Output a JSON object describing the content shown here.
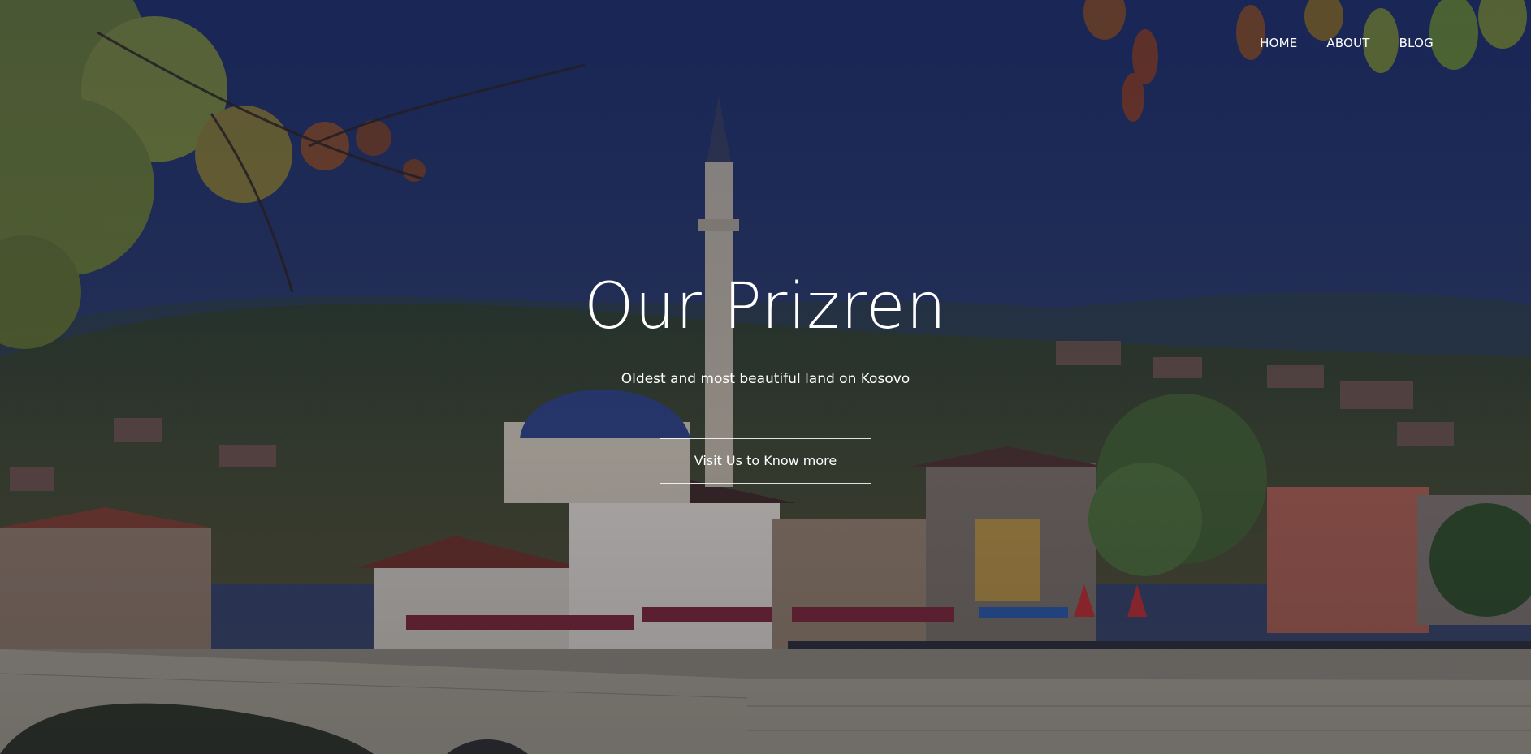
{
  "nav": {
    "home_label": "HOME",
    "about_label": "ABOUT",
    "blog_label": "BLOG"
  },
  "hero": {
    "title": "Our Prizren",
    "subtitle": "Oldest and most beautiful land on Kosovo",
    "cta_label": "Visit Us to Know more"
  },
  "colors": {
    "sky": "#1f2d5c",
    "hills": "#2e3a2a",
    "text": "#ffffff"
  }
}
